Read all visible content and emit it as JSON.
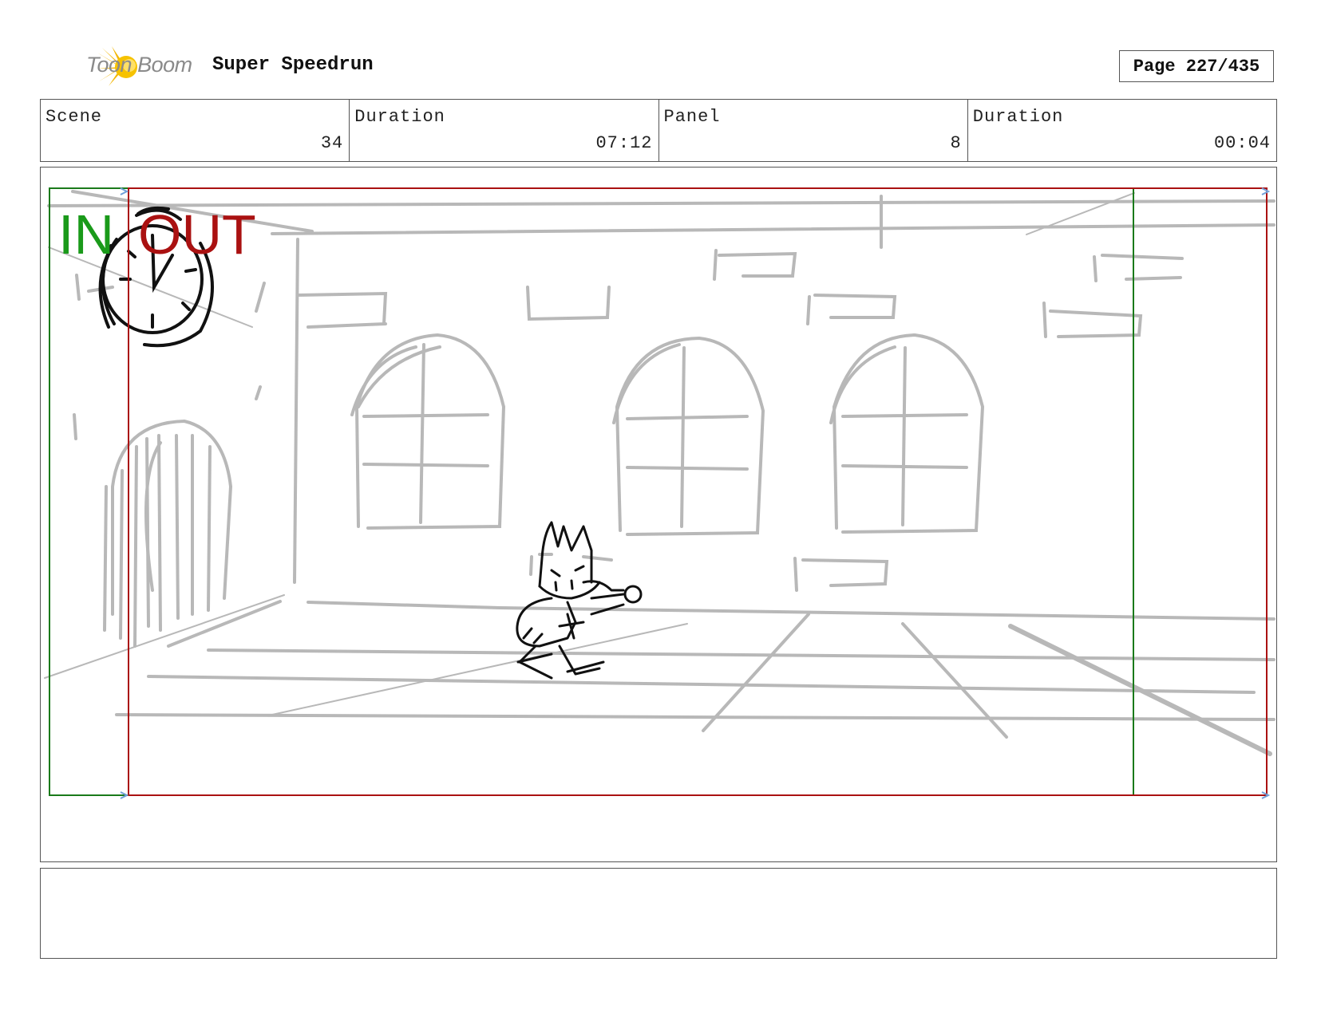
{
  "header": {
    "logo_text": "Toon Boom",
    "project_title": "Super Speedrun",
    "page_label": "Page 227/435"
  },
  "info": [
    {
      "label": "Scene",
      "value": "34"
    },
    {
      "label": "Duration",
      "value": "07:12"
    },
    {
      "label": "Panel",
      "value": "8"
    },
    {
      "label": "Duration",
      "value": "00:04"
    }
  ],
  "panel": {
    "in_marker": "IN",
    "out_marker": "OUT",
    "in_color": "#1a9a1a",
    "out_color": "#aa1111"
  },
  "notes": {
    "text": ""
  }
}
